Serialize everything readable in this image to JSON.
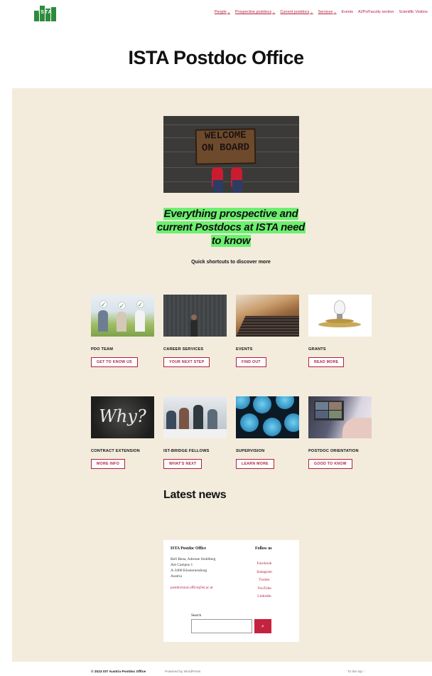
{
  "header": {
    "logo_text": "ISTA",
    "nav": [
      {
        "label": "People",
        "dropdown": true
      },
      {
        "label": "Prospective postdocs",
        "dropdown": true
      },
      {
        "label": "Current postdocs",
        "dropdown": true
      },
      {
        "label": "Services",
        "dropdown": true
      },
      {
        "label": "Events",
        "dropdown": false
      },
      {
        "label": "A2Ps/Faculty section",
        "dropdown": false
      },
      {
        "label": "Scientific Visitors",
        "dropdown": false
      }
    ]
  },
  "site_title": "ISTA Postdoc Office",
  "hero": {
    "mat_line1": "WELCOME",
    "mat_line2": "ON BOARD",
    "tagline": "Everything prospective and current Postdocs at ISTA need to know",
    "subtitle": "Quick shortcuts to discover more"
  },
  "cards": [
    {
      "label": "PDO TEAM",
      "button": "GET TO KNOW US"
    },
    {
      "label": "CAREER SERVICES",
      "button": "YOUR NEXT STEP"
    },
    {
      "label": "EVENTS",
      "button": "FIND OUT"
    },
    {
      "label": "GRANTS",
      "button": "READ MORE"
    },
    {
      "label": "CONTRACT EXTENSION",
      "button": "MORE INFO",
      "img_text": "Why?"
    },
    {
      "label": "IST-BRIDGE FELLOWS",
      "button": "WHAT'S NEXT"
    },
    {
      "label": "SUPERVISION",
      "button": "LEARN MORE"
    },
    {
      "label": "POSTDOC ORIENTATION",
      "button": "GOOD TO KNOW"
    }
  ],
  "latest_news": "Latest news",
  "footer_widget": {
    "title": "ISTA Postdoc Office",
    "address": [
      "Bell Bena, Adresse Stuhlberg",
      "Am Campus 1",
      "A-3400 Klosterneuburg",
      "Austria"
    ],
    "email": "postdoctoral.office@ist.ac.at",
    "follow_title": "Follow us",
    "social": [
      "Facebook",
      "Instagram",
      "Twitter",
      "YouTube",
      "Linkedin"
    ],
    "search_label": "Search",
    "search_button_icon": "search-icon"
  },
  "bottom": {
    "copyright": "© 2023 IST Austria Postdoc Office",
    "powered": "Powered by WordPress",
    "to_top": "To the top ↑"
  },
  "colors": {
    "accent": "#b21f40",
    "highlight": "#6cf06f",
    "beige": "#f3ecdd",
    "logo": "#2e8b3c"
  }
}
